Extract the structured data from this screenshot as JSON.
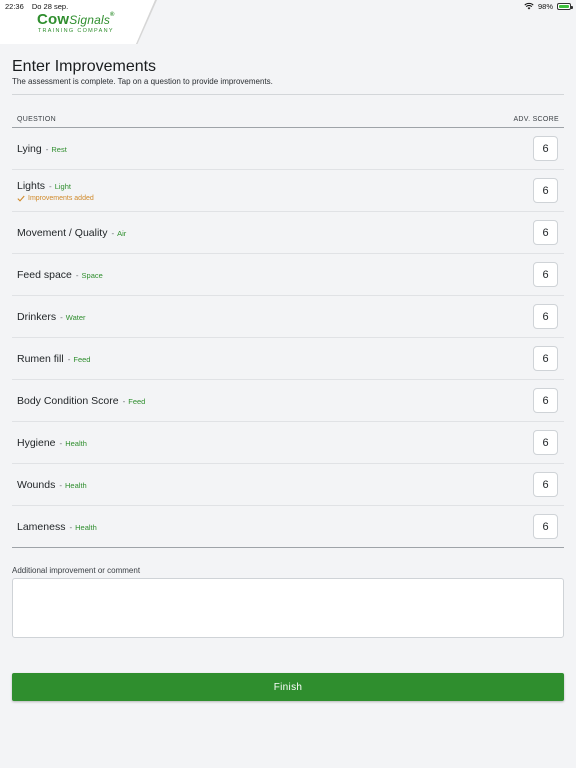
{
  "status_bar": {
    "time": "22:36",
    "date": "Do 28 sep.",
    "battery": "98%"
  },
  "logo": {
    "main_a": "Cow",
    "main_b": "Signals",
    "reg": "®",
    "sub": "TRAINING COMPANY"
  },
  "header": {
    "title": "Enter Improvements",
    "subtitle": "The assessment is complete. Tap on a question to provide improvements."
  },
  "table": {
    "col_question": "QUESTION",
    "col_score": "ADV. SCORE",
    "rows": [
      {
        "name": "Lying",
        "category": "Rest",
        "score": "6",
        "note": ""
      },
      {
        "name": "Lights",
        "category": "Light",
        "score": "6",
        "note": "Improvements added"
      },
      {
        "name": "Movement / Quality",
        "category": "Air",
        "score": "6",
        "note": ""
      },
      {
        "name": "Feed space",
        "category": "Space",
        "score": "6",
        "note": ""
      },
      {
        "name": "Drinkers",
        "category": "Water",
        "score": "6",
        "note": ""
      },
      {
        "name": "Rumen fill",
        "category": "Feed",
        "score": "6",
        "note": ""
      },
      {
        "name": "Body Condition Score",
        "category": "Feed",
        "score": "6",
        "note": ""
      },
      {
        "name": "Hygiene",
        "category": "Health",
        "score": "6",
        "note": ""
      },
      {
        "name": "Wounds",
        "category": "Health",
        "score": "6",
        "note": ""
      },
      {
        "name": "Lameness",
        "category": "Health",
        "score": "6",
        "note": ""
      }
    ]
  },
  "comment": {
    "label": "Additional improvement or comment",
    "value": "",
    "placeholder": ""
  },
  "finish_label": "Finish",
  "colors": {
    "accent": "#2f8e2e",
    "note": "#d08a2b"
  },
  "icons": {
    "note": "checkmark-icon",
    "wifi": "wifi-icon",
    "battery": "battery-icon"
  }
}
